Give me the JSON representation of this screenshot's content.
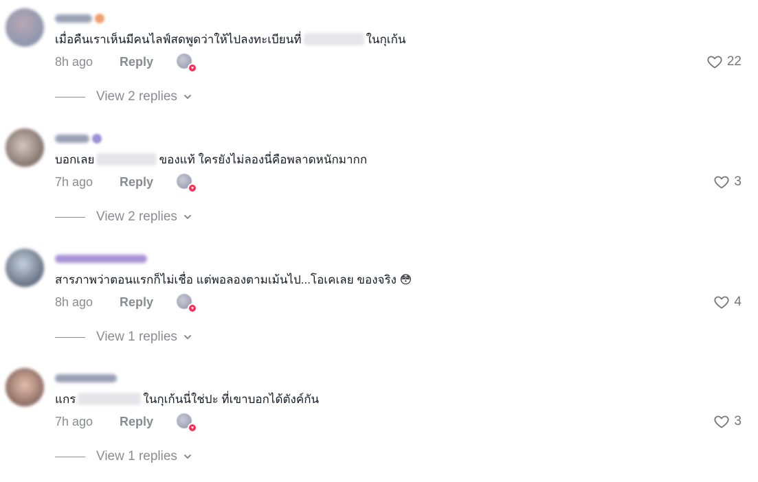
{
  "comments": [
    {
      "text_before": "เมื่อคืนเราเห็นมีคนไลฟ์สดพูดว่าให้ไปลงทะเบียนที่",
      "text_after": "ในกุเก้น",
      "time": "8h ago",
      "reply_label": "Reply",
      "likes": "22",
      "view_replies": "View 2 replies"
    },
    {
      "text_before": "บอกเลย",
      "text_after": "ของแท้ ใครยังไม่ลองนี่คือพลาดหนักมากก",
      "time": "7h ago",
      "reply_label": "Reply",
      "likes": "3",
      "view_replies": "View 2 replies"
    },
    {
      "text_before": "สารภาพว่าตอนแรกก็ไม่เชื่อ แต่พอลองตามเม้นไป...โอเคเลย ของจริง 😳",
      "text_after": "",
      "time": "8h ago",
      "reply_label": "Reply",
      "likes": "4",
      "view_replies": "View 1 replies"
    },
    {
      "text_before": "แกร",
      "text_after": "ในกุเก้นนี่ใช่ปะ ที่เขาบอกได้ตังค์กัน",
      "time": "7h ago",
      "reply_label": "Reply",
      "likes": "3",
      "view_replies": "View 1 replies"
    }
  ],
  "colors": {
    "text": "#161823",
    "muted": "#8a8b91",
    "like_icon": "#73747b",
    "creator_heart": "#fe2c55"
  },
  "icons": {
    "like": "heart-outline-icon",
    "expand": "chevron-down-icon",
    "creator_liked": "creator-liked-badge-icon"
  }
}
